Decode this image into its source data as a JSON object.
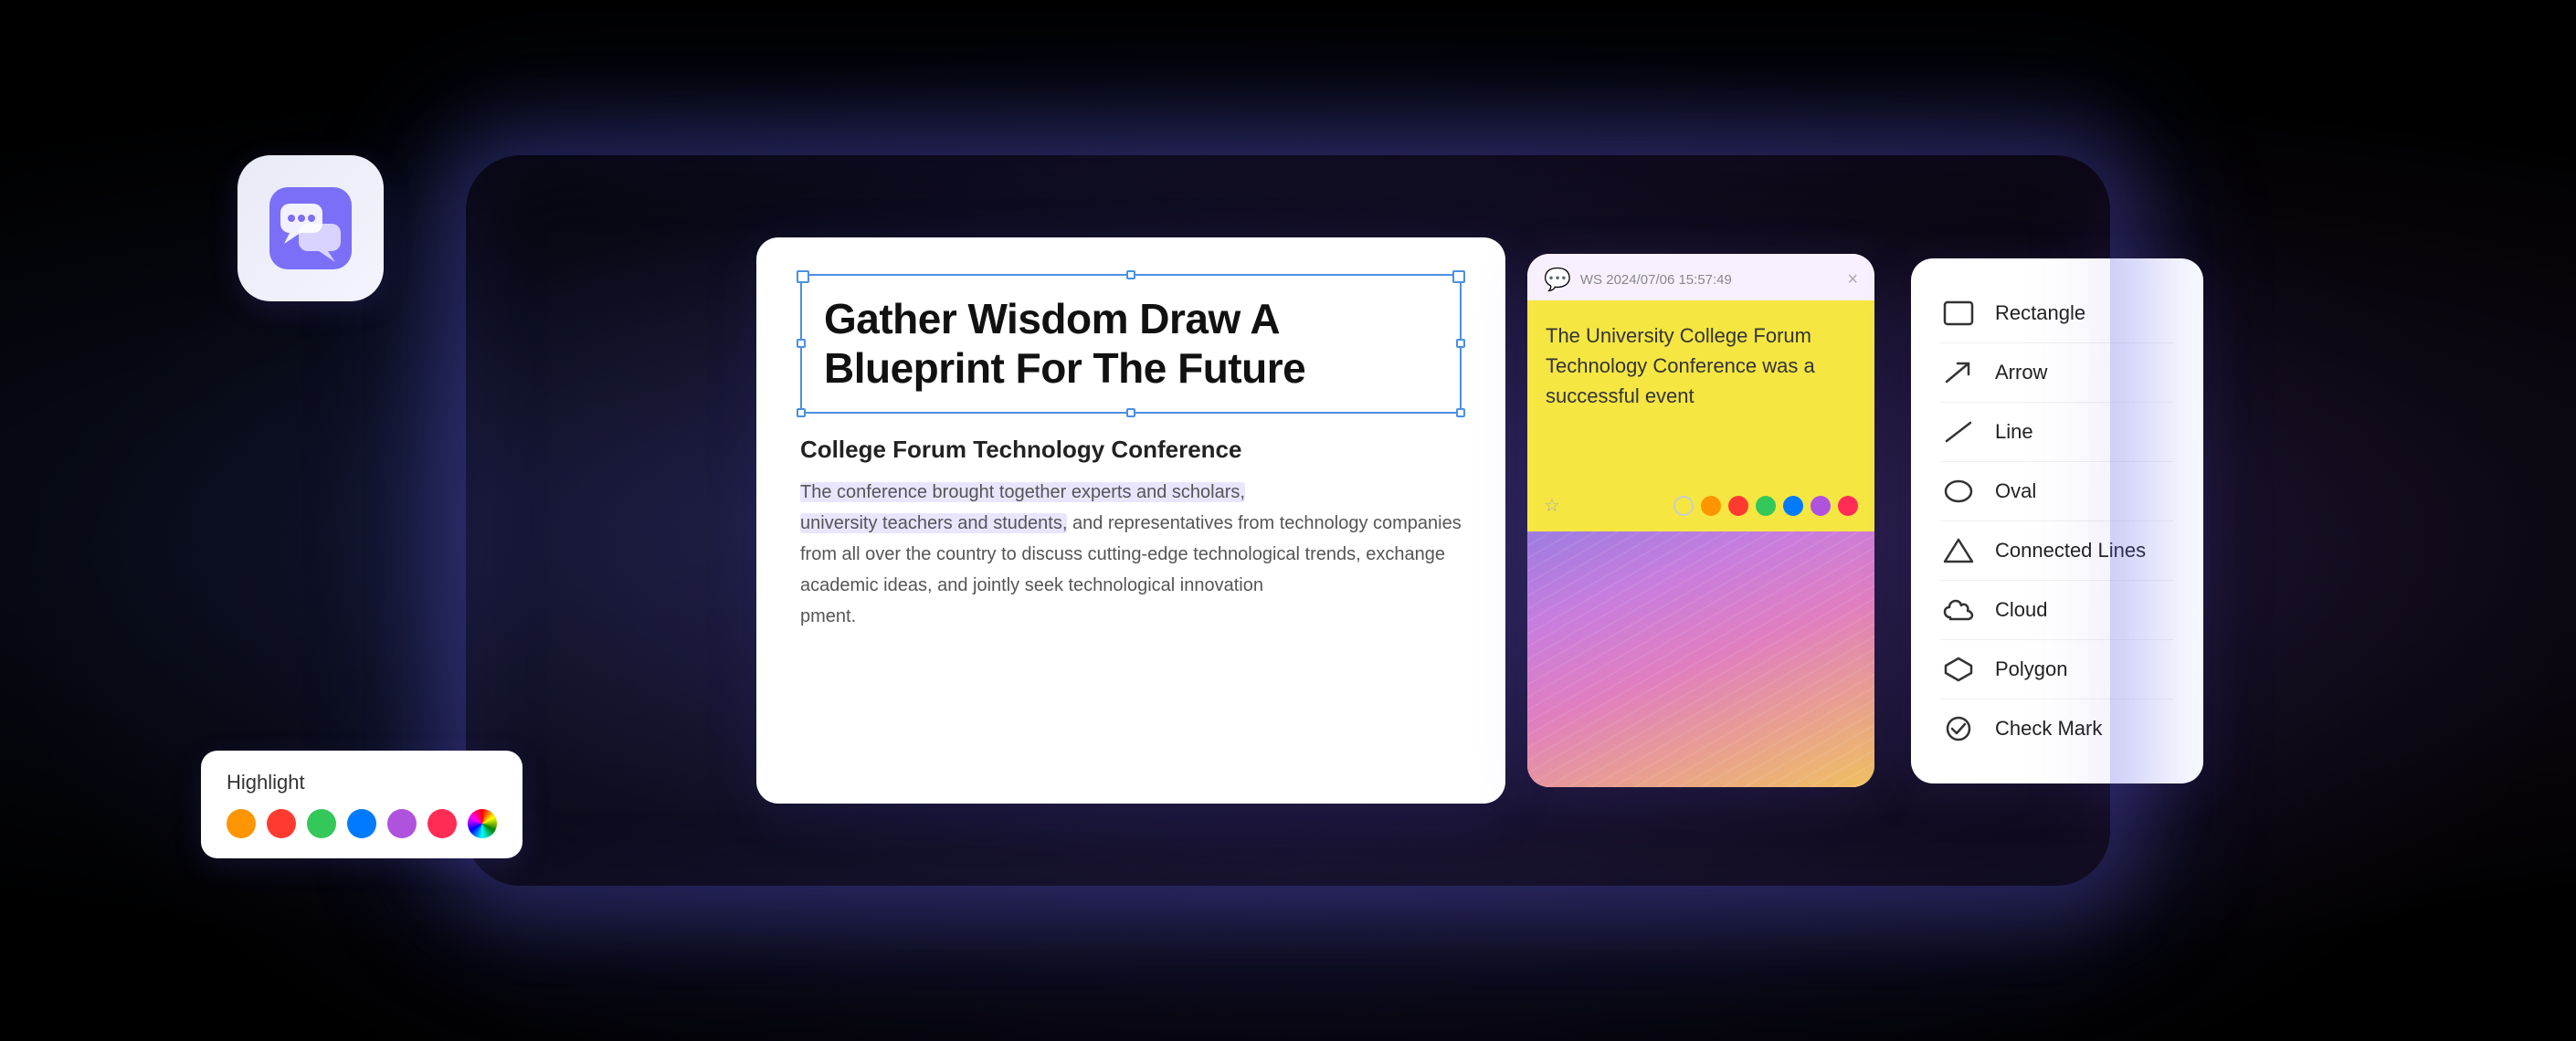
{
  "app": {
    "background": "#000"
  },
  "app_icon": {
    "alt": "App icon with chat bubbles"
  },
  "highlight_panel": {
    "label": "Highlight",
    "colors": [
      {
        "name": "orange",
        "hex": "#FF9500"
      },
      {
        "name": "red",
        "hex": "#FF3B30"
      },
      {
        "name": "green",
        "hex": "#34C759"
      },
      {
        "name": "blue",
        "hex": "#007AFF"
      },
      {
        "name": "purple",
        "hex": "#AF52DE"
      },
      {
        "name": "pink",
        "hex": "#FF2D55"
      },
      {
        "name": "multicolor",
        "hex": "conic-gradient(red, yellow, green, blue, purple, red)"
      }
    ]
  },
  "document": {
    "headline": "Gather Wisdom Draw A Blueprint For The Future",
    "section_title": "College Forum Technology Conference",
    "body_text_1": "The conference brought together experts and scholars,",
    "body_text_highlighted": "university teachers and students,",
    "body_text_2": " and representatives from technology companies from all over the country to discuss cutting-edge technological trends, exchange academic ideas, and jointly seek technological innovation",
    "body_text_3": "pment."
  },
  "sticky_note": {
    "icon": "💬",
    "meta": "WS  2024/07/06  15:57:49",
    "close": "×",
    "text": "The University College Forum Technology Conference was a successful event",
    "star": "☆",
    "colors": [
      {
        "name": "yellow",
        "hex": "#f5e642"
      },
      {
        "name": "orange",
        "hex": "#FF9500"
      },
      {
        "name": "red",
        "hex": "#FF3B30"
      },
      {
        "name": "green",
        "hex": "#34C759"
      },
      {
        "name": "blue",
        "hex": "#007AFF"
      },
      {
        "name": "purple",
        "hex": "#AF52DE"
      },
      {
        "name": "pink",
        "hex": "#FF2D55"
      }
    ]
  },
  "shapes_panel": {
    "items": [
      {
        "label": "Rectangle",
        "icon": "rectangle"
      },
      {
        "label": "Arrow",
        "icon": "arrow"
      },
      {
        "label": "Line",
        "icon": "line"
      },
      {
        "label": "Oval",
        "icon": "oval"
      },
      {
        "label": "Connected Lines",
        "icon": "connected-lines"
      },
      {
        "label": "Cloud",
        "icon": "cloud"
      },
      {
        "label": "Polygon",
        "icon": "polygon"
      },
      {
        "label": "Check Mark",
        "icon": "check-mark"
      }
    ]
  }
}
